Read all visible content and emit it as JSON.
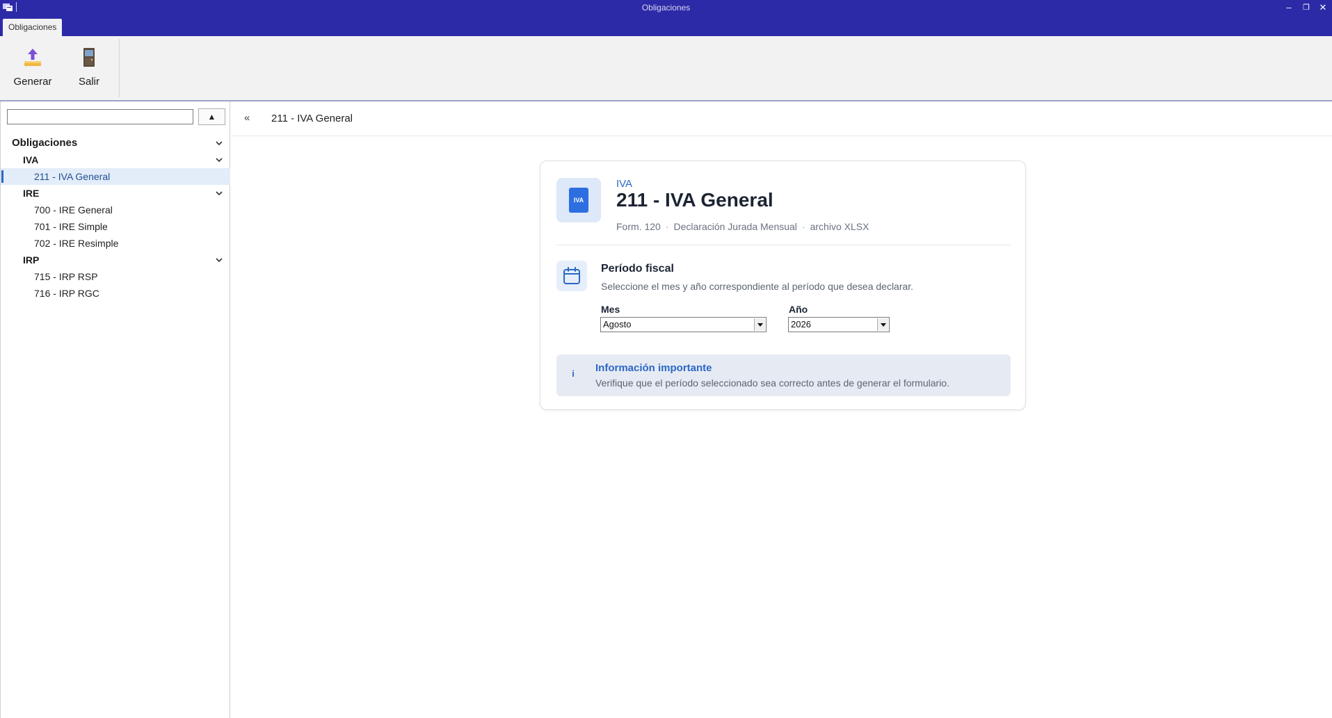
{
  "window": {
    "title": "Obligaciones",
    "minimize_glyph": "–",
    "restore_glyph": "❐",
    "close_glyph": "✕"
  },
  "ribbon": {
    "tab_label": "Obligaciones",
    "buttons": [
      {
        "label": "Generar",
        "icon": "upload-icon"
      },
      {
        "label": "Salir",
        "icon": "exit-door-icon"
      }
    ]
  },
  "sidebar": {
    "search_value": "",
    "collapse_glyph": "▲",
    "tree": {
      "root": "Obligaciones",
      "groups": [
        {
          "label": "IVA",
          "items": [
            "211 - IVA General"
          ]
        },
        {
          "label": "IRE",
          "items": [
            "700 - IRE General",
            "701 - IRE Simple",
            "702 - IRE Resimple"
          ]
        },
        {
          "label": "IRP",
          "items": [
            "715 - IRP RSP",
            "716 - IRP RGC"
          ]
        }
      ],
      "selected": "211 - IVA General"
    }
  },
  "main": {
    "back_glyph": "«",
    "breadcrumb": "211 - IVA General",
    "card": {
      "badge_text": "IVA",
      "category": "IVA",
      "title": "211 - IVA General",
      "meta": [
        "Form. 120",
        "Declaración Jurada Mensual",
        "archivo XLSX"
      ],
      "meta_separator": "·",
      "period_title": "Período fiscal",
      "period_description": "Seleccione el mes y año correspondiente al período que desea declarar.",
      "mes_label": "Mes",
      "mes_value": "Agosto",
      "anio_label": "Año",
      "anio_value": "2026",
      "info_icon": "i",
      "info_title": "Información importante",
      "info_text": "Verifique que el período seleccionado sea correcto antes de generar el formulario."
    }
  },
  "colors": {
    "titlebar": "#2d2aa8",
    "accent": "#2b67c6",
    "selection_bg": "#e3ecf9",
    "info_bg": "#e6ebf3"
  }
}
